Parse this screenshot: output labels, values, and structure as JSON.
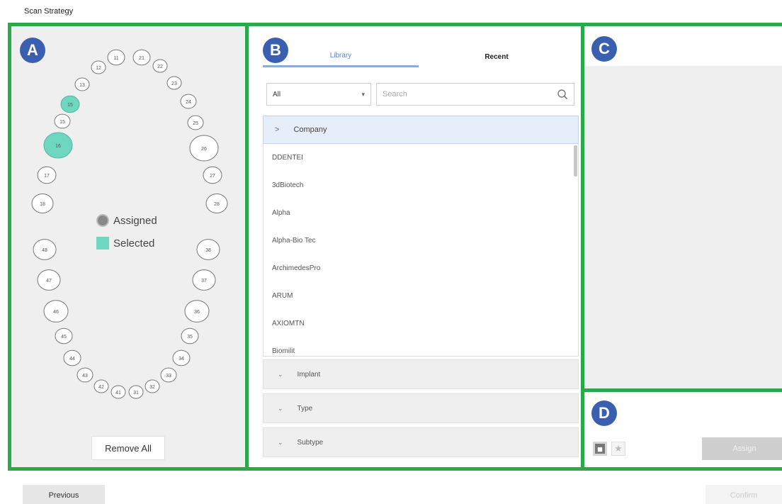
{
  "page": {
    "title": "Scan Strategy"
  },
  "badges": {
    "a": "A",
    "b": "B",
    "c": "C",
    "d": "D"
  },
  "tooth_chart": {
    "teeth": [
      {
        "num": "11",
        "state": "default"
      },
      {
        "num": "12",
        "state": "default"
      },
      {
        "num": "13",
        "state": "default"
      },
      {
        "num": "15",
        "state": "selected"
      },
      {
        "num": "15",
        "state": "default"
      },
      {
        "num": "16",
        "state": "selected"
      },
      {
        "num": "17",
        "state": "default"
      },
      {
        "num": "18",
        "state": "default"
      },
      {
        "num": "21",
        "state": "default"
      },
      {
        "num": "22",
        "state": "default"
      },
      {
        "num": "23",
        "state": "default"
      },
      {
        "num": "24",
        "state": "default"
      },
      {
        "num": "25",
        "state": "default"
      },
      {
        "num": "26",
        "state": "default"
      },
      {
        "num": "27",
        "state": "default"
      },
      {
        "num": "28",
        "state": "default"
      },
      {
        "num": "48",
        "state": "default"
      },
      {
        "num": "47",
        "state": "default"
      },
      {
        "num": "46",
        "state": "default"
      },
      {
        "num": "45",
        "state": "default"
      },
      {
        "num": "44",
        "state": "default"
      },
      {
        "num": "43",
        "state": "default"
      },
      {
        "num": "42",
        "state": "default"
      },
      {
        "num": "41",
        "state": "default"
      },
      {
        "num": "31",
        "state": "default"
      },
      {
        "num": "32",
        "state": "default"
      },
      {
        "num": "33",
        "state": "default"
      },
      {
        "num": "34",
        "state": "default"
      },
      {
        "num": "35",
        "state": "default"
      },
      {
        "num": "36",
        "state": "default"
      },
      {
        "num": "37",
        "state": "default"
      },
      {
        "num": "38",
        "state": "default"
      }
    ],
    "colors": {
      "selected": "#6fd6c0",
      "assigned": "#888888",
      "default": "#ffffff"
    }
  },
  "legend": {
    "assigned": "Assigned",
    "selected": "Selected"
  },
  "actions": {
    "remove_all": "Remove All",
    "previous": "Previous",
    "confirm": "Confirm",
    "assign": "Assign"
  },
  "library": {
    "tabs": {
      "library": "Library",
      "recent": "Recent"
    },
    "filter": {
      "selected": "All",
      "arrow": "▾"
    },
    "search": {
      "placeholder": "Search",
      "icon": "search-icon"
    },
    "company_header": "Company",
    "companies": [
      "DDENTEI",
      "3dBiotech",
      "Alpha",
      "Alpha-Bio Tec",
      "ArchimedesPro",
      "ARUM",
      "AXIOMTN",
      "Biomilit"
    ],
    "sections": [
      "Implant",
      "Type",
      "Subtype"
    ]
  },
  "accent": {
    "frame": "#2aa84a",
    "badge": "#3b5fb0"
  }
}
